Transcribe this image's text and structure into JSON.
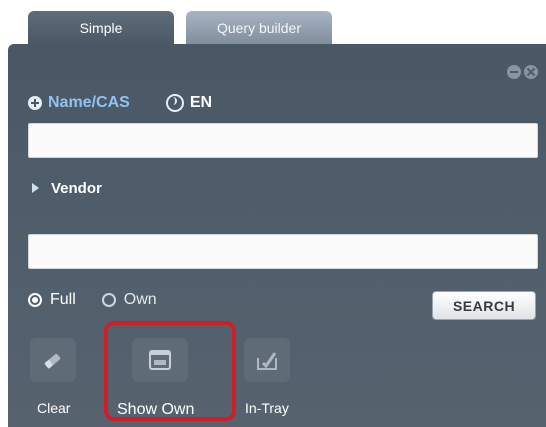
{
  "tabs": [
    {
      "label": "Simple",
      "active": true
    },
    {
      "label": "Query builder",
      "active": false
    }
  ],
  "window_controls": {
    "minimize_icon": "minus-circle-icon",
    "close_icon": "close-circle-icon"
  },
  "search_mode": {
    "name_cas_label": "Name/CAS",
    "name_cas_icon": "plus-circle-icon",
    "language_label": "EN",
    "language_icon": "globe-icon",
    "name_cas_color": "#8fc3f2"
  },
  "name_input": {
    "value": "",
    "placeholder": ""
  },
  "vendor": {
    "label": "Vendor",
    "icon": "triangle-right-icon",
    "input_value": "",
    "input_placeholder": ""
  },
  "scope": {
    "options": [
      {
        "label": "Full",
        "checked": true
      },
      {
        "label": "Own",
        "checked": false
      }
    ]
  },
  "search_button": {
    "label": "SEARCH"
  },
  "tools": [
    {
      "label": "Clear",
      "icon": "eraser-icon"
    },
    {
      "label": "Show Own",
      "icon": "folder-icon",
      "highlighted": true
    },
    {
      "label": "In-Tray",
      "icon": "tray-icon"
    }
  ],
  "colors": {
    "panel": "#4f5c68",
    "highlight": "#cf1d2a",
    "accent": "#8fc3f2"
  }
}
